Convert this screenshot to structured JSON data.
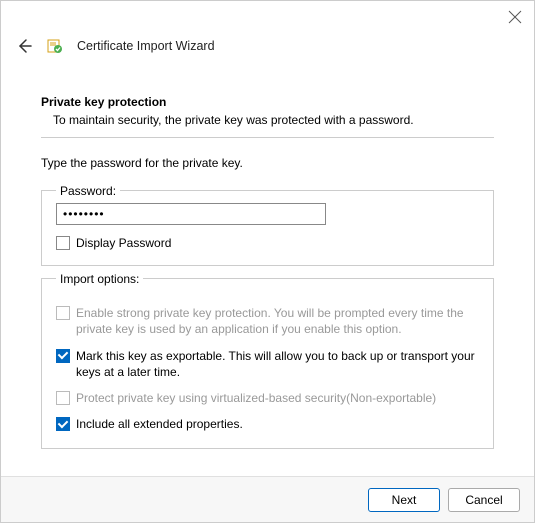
{
  "window": {
    "title": "Certificate Import Wizard"
  },
  "section": {
    "title": "Private key protection",
    "description": "To maintain security, the private key was protected with a password."
  },
  "instruction": "Type the password for the private key.",
  "password_group": {
    "legend": "Password:",
    "value": "••••••••",
    "display_label": "Display Password"
  },
  "import_group": {
    "legend": "Import options:",
    "options": [
      {
        "label": "Enable strong private key protection. You will be prompted every time the private key is used by an application if you enable this option.",
        "checked": false,
        "disabled": true
      },
      {
        "label": "Mark this key as exportable. This will allow you to back up or transport your keys at a later time.",
        "checked": true,
        "disabled": false
      },
      {
        "label": "Protect private key using virtualized-based security(Non-exportable)",
        "checked": false,
        "disabled": true
      },
      {
        "label": "Include all extended properties.",
        "checked": true,
        "disabled": false
      }
    ]
  },
  "footer": {
    "next": "Next",
    "cancel": "Cancel"
  }
}
